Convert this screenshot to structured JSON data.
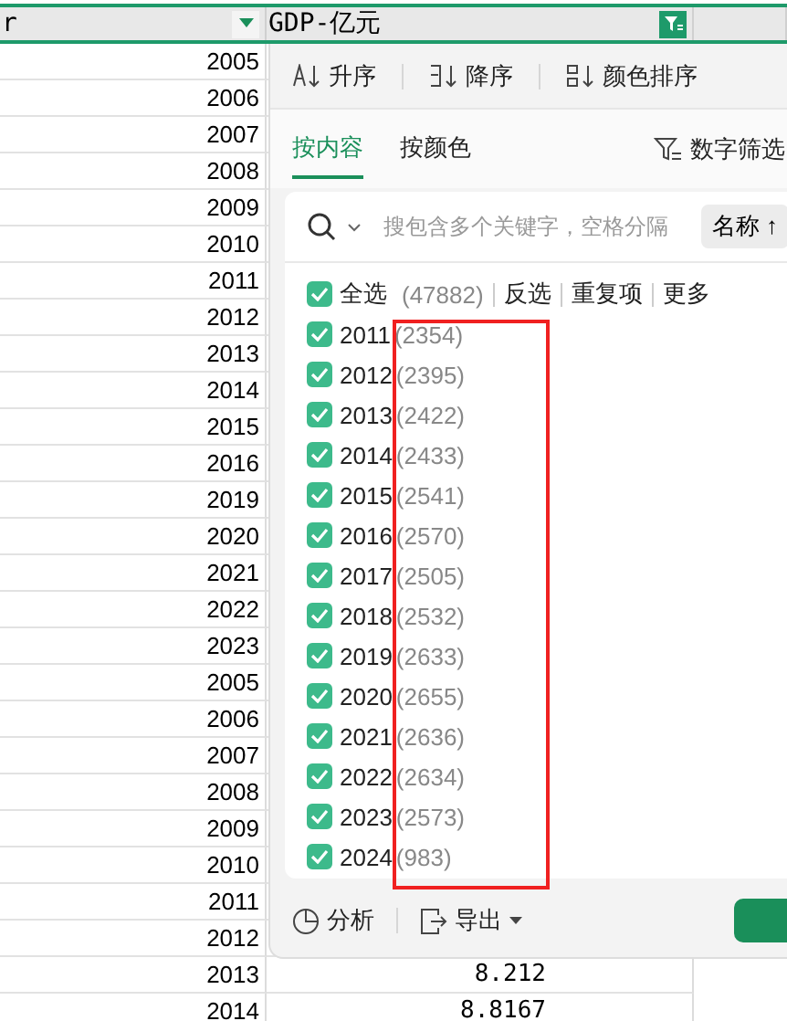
{
  "sheet": {
    "columns": [
      {
        "header": "r",
        "filter_active": false
      },
      {
        "header": "GDP-亿元",
        "filter_active": true
      }
    ],
    "rows": [
      {
        "a": "2005"
      },
      {
        "a": "2006"
      },
      {
        "a": "2007"
      },
      {
        "a": "2008"
      },
      {
        "a": "2009"
      },
      {
        "a": "2010"
      },
      {
        "a": "2011"
      },
      {
        "a": "2012"
      },
      {
        "a": "2013"
      },
      {
        "a": "2014"
      },
      {
        "a": "2015"
      },
      {
        "a": "2016"
      },
      {
        "a": "2019"
      },
      {
        "a": "2020"
      },
      {
        "a": "2021"
      },
      {
        "a": "2022"
      },
      {
        "a": "2023"
      },
      {
        "a": "2005"
      },
      {
        "a": "2006"
      },
      {
        "a": "2007"
      },
      {
        "a": "2008"
      },
      {
        "a": "2009"
      },
      {
        "a": "2010"
      },
      {
        "a": "2011"
      },
      {
        "a": "2012"
      },
      {
        "a": "2013",
        "b": "8.212"
      },
      {
        "a": "2014",
        "b": "8.8167"
      }
    ]
  },
  "filter_panel": {
    "sort_toolbar": [
      {
        "kind": "ascending",
        "label": "升序"
      },
      {
        "kind": "descending",
        "label": "降序"
      },
      {
        "kind": "color",
        "label": "颜色排序"
      }
    ],
    "tabs": [
      {
        "label": "按内容",
        "selected": true
      },
      {
        "label": "按颜色",
        "selected": false
      }
    ],
    "number_filter": "数字筛选",
    "search": {
      "placeholder": "搜包含多个关键字，空格分隔"
    },
    "sort_button": "名称 ↑",
    "select_all": {
      "label": "全选",
      "count": "(47882)",
      "checked": true
    },
    "actions": [
      "反选",
      "重复项",
      "更多"
    ],
    "values": [
      {
        "label": "2011",
        "count": "(2354)",
        "checked": true
      },
      {
        "label": "2012",
        "count": "(2395)",
        "checked": true
      },
      {
        "label": "2013",
        "count": "(2422)",
        "checked": true
      },
      {
        "label": "2014",
        "count": "(2433)",
        "checked": true
      },
      {
        "label": "2015",
        "count": "(2541)",
        "checked": true
      },
      {
        "label": "2016",
        "count": "(2570)",
        "checked": true
      },
      {
        "label": "2017",
        "count": "(2505)",
        "checked": true
      },
      {
        "label": "2018",
        "count": "(2532)",
        "checked": true
      },
      {
        "label": "2019",
        "count": "(2633)",
        "checked": true
      },
      {
        "label": "2020",
        "count": "(2655)",
        "checked": true
      },
      {
        "label": "2021",
        "count": "(2636)",
        "checked": true
      },
      {
        "label": "2022",
        "count": "(2634)",
        "checked": true
      },
      {
        "label": "2023",
        "count": "(2573)",
        "checked": true
      },
      {
        "label": "2024",
        "count": "(983)",
        "checked": true
      }
    ],
    "footer": {
      "analyze": "分析",
      "export": "导出"
    }
  }
}
